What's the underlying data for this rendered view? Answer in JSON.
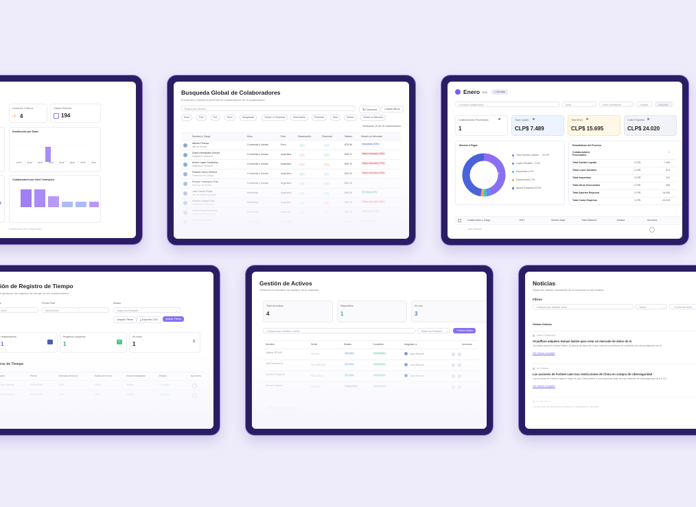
{
  "colors": {
    "accent": "#7c5cf0",
    "tablet_frame": "#2a1d63",
    "background": "#eeebfb"
  },
  "t1": {
    "card_a": "Usuarios Críticos",
    "card_a_value": "4",
    "card_b": "Vistas Ficticias",
    "card_b_value": "194",
    "chart1_title": "Distribución por Edad",
    "chart1_ticks": [
      "20-25",
      "25-30",
      "30-35",
      "35-40",
      "40-45",
      "45-50",
      "50-55",
      "55-60"
    ],
    "chart2_title": "Colaboradores por Nivel Jerárquico",
    "footer": "Distribución de Antigüedad"
  },
  "t2": {
    "title": "Busqueda Global de Colaboradores",
    "subtitle": "Encuentra y explora el perfil de los colaboradores de tu organización.",
    "search_placeholder": "Busca por nombre...",
    "btn_columns": "Columnas",
    "btn_clear": "Limpiar filtros",
    "chips": [
      "Edad",
      "País",
      "Rol",
      "Nivel",
      "Antigüedad",
      "Tiempo en Empresa",
      "Desempeño",
      "Potencial",
      "Área",
      "Salario",
      "Salario vs Mercado"
    ],
    "count": "Mostrando 10 de 25 colaboradores",
    "headers": [
      "Nombre y Cargo",
      "Área",
      "País",
      "Desempeño",
      "Potencial",
      "Salario",
      "Salario vs Mercado"
    ],
    "rows": [
      {
        "name": "Alfredo Pereira",
        "role": "Jefe de Ventas",
        "area": "Comercial y Ventas",
        "country": "Perú",
        "salary": "$75,99",
        "market": "Buscando (+4%)",
        "mc": "#e8f0ff",
        "mt": "#6a7fd8"
      },
      {
        "name": "Dulce Hernandez Gomez",
        "role": "Analista de Ventas Sr",
        "area": "Comercial y Ventas",
        "country": "Argentina",
        "salary": "$45,21",
        "market": "Mayor mercado (+8%)",
        "mc": "#fde6e6",
        "mt": "#d05050"
      },
      {
        "name": "Arturo López Contreras",
        "role": "Analista de Ventas Sr",
        "area": "Comercial y Ventas",
        "country": "Argentina",
        "salary": "$49,70",
        "market": "Mayor mercado (+7%)",
        "mc": "#fde6e6",
        "mt": "#d05050"
      },
      {
        "name": "Rafaela Yepes Medina",
        "role": "Vendedora de Campo",
        "area": "Comercial y Ventas",
        "country": "Argentina",
        "salary": "$26,02",
        "market": "Mayor mercado (+9%)",
        "mc": "#fde6e6",
        "mt": "#d05050"
      },
      {
        "name": "Enrique Velázquez Ruiz",
        "role": "Ejecutivo de Ventas",
        "area": "Comercial y Ventas",
        "country": "Argentina",
        "salary": "$32,10",
        "market": "-",
        "mc": "#ffffff",
        "mt": "#999999"
      },
      {
        "name": "Juan Carlos Rojas",
        "role": "Jefe de Marketing Digital",
        "area": "Marketing",
        "country": "Argentina",
        "salary": "$66,30",
        "market": "En rango (0%)",
        "mc": "#e6f7ee",
        "mt": "#3aa46a"
      },
      {
        "name": "Ximena Ortega Ruiz",
        "role": "Analista de Marketing",
        "area": "Marketing",
        "country": "Argentina",
        "salary": "$34,75",
        "market": "Mayor mercado (+5%)",
        "mc": "#fde6e6",
        "mt": "#d05050"
      },
      {
        "name": "Carlos Pérez Espinoza",
        "role": "Analista de Marketing Sr",
        "area": "Marketing",
        "country": "Argentina",
        "salary": "$40,18",
        "market": "Buscando (+2%)",
        "mc": "#e8f0ff",
        "mt": "#6a7fd8"
      },
      {
        "name": "Luisa Moreno Díaz",
        "role": "Diseñadora Gráfica",
        "area": "Marketing",
        "country": "Argentina",
        "salary": "$28,40",
        "market": "En rango (0%)",
        "mc": "#e6f7ee",
        "mt": "#3aa46a"
      }
    ]
  },
  "t3": {
    "month": "Enero",
    "year": "2026",
    "status": "Cerrado",
    "search_placeholder": "Buscar colaborador...",
    "filter_a": "Área",
    "filter_b": "Nivel Jerárquico",
    "btn_a": "Limpiar",
    "btn_b": "Exportar",
    "kpis": [
      {
        "label": "Colaboradores Procesados",
        "value": "1"
      },
      {
        "label": "Total Líquido",
        "value": "CLP$ 7.489"
      },
      {
        "label": "Total Bruto",
        "value": "CLP$ 15.695"
      },
      {
        "label": "Costo Empresa",
        "value": "CLP$ 24.020"
      }
    ],
    "donut_title": "Montos a Pagar",
    "donut_center": "24.020",
    "legend": [
      {
        "name": "Total Sueldo Líquido",
        "pct": "31.2%",
        "color": "#8a6ff2"
      },
      {
        "name": "Leyes Sociales",
        "pct": "2.4%",
        "color": "#5b8def"
      },
      {
        "name": "Impuestos",
        "pct": "1.4%",
        "color": "#3fc7c2"
      },
      {
        "name": "Descuentos",
        "pct": "1.7%",
        "color": "#f4a451"
      },
      {
        "name": "Aporte Empresa",
        "pct": "33.3%",
        "color": "#4b63d8"
      }
    ],
    "stats_title": "Estadísticas del Proceso",
    "stats": [
      {
        "k": "Colaboradores Procesados",
        "c": "",
        "v": "1"
      },
      {
        "k": "Total Sueldo Líquido",
        "c": "CLP$",
        "v": "7.489"
      },
      {
        "k": "Total Leyes Sociales",
        "c": "CLP$",
        "v": "512"
      },
      {
        "k": "Total Impuestos",
        "c": "CLP$",
        "v": "312"
      },
      {
        "k": "Total Otros Descuentos",
        "c": "CLP$",
        "v": "496"
      },
      {
        "k": "Total Aportes Empresa",
        "c": "CLP$",
        "v": "16.495"
      },
      {
        "k": "Total Costo Empresa",
        "c": "CLP$",
        "v": "24.020"
      }
    ],
    "table_headers": [
      "Colaborador y Cargo",
      "RUT",
      "Sueldo Base",
      "Total Haberes",
      "Estado",
      "Acciones"
    ],
    "table_row": "Juan Manuel"
  },
  "t4": {
    "title": "ión de Registro de Tiempo",
    "subtitle": "a gestionar los registros de tiempo de tus colaboradores",
    "field_a": "o",
    "field_a_value": "2026",
    "field_b": "Fecha Final",
    "field_b_value": "30/01/2026",
    "field_c": "Estado",
    "field_c_value": "Todos los Estados",
    "btn_clear": "Limpiar Filtros",
    "btn_export": "Exportar CSV",
    "btn_apply": "Aplicar Filtros",
    "cards": [
      {
        "label": "colaboradores",
        "value": "1"
      },
      {
        "label": "Registros completos",
        "value": "1"
      },
      {
        "label": "En curso",
        "value": "1"
      }
    ],
    "section": "ros de Tiempo",
    "headers": [
      "ador",
      "Fecha",
      "Entrada del turno",
      "Salida del turno",
      "Horas trabajadas",
      "Estado",
      "Acciones"
    ],
    "rows": [
      {
        "name": "Juan Manuel",
        "date": "05/01/2026",
        "in": "8:15",
        "out": "18:00",
        "hours": "9h45m",
        "state": "Completo"
      },
      {
        "name": "Juan Manuel",
        "date": "06/01/2026",
        "in": "8:30",
        "out": "18:00",
        "hours": "9h30m",
        "state": "Completo"
      }
    ]
  },
  "t5": {
    "title": "Gestión de Activos",
    "subtitle": "Gestiona el inventario de equipos de tu empresa",
    "cards": [
      {
        "label": "Total de Activos",
        "value": "4"
      },
      {
        "label": "Disponibles",
        "value": "1"
      },
      {
        "label": "En Uso",
        "value": "3"
      }
    ],
    "search_placeholder": "Buscar por nombre o serie...",
    "filter": "Todas las Estados",
    "btn_new": "+ Nuevo Activo",
    "headers": [
      "Nombre",
      "Serial",
      "Estado",
      "Condición",
      "Asignado a",
      "Acciones"
    ],
    "rows": [
      {
        "name": "Laptop HP 640",
        "serial": "SN-000",
        "state": "En Uso",
        "cond": "Excelente",
        "who": "Juan Manuel"
      },
      {
        "name": "Dell Precision 5",
        "serial": "SN-1930-201",
        "state": "En Uso",
        "cond": "Excelente",
        "who": "Juan Manuel"
      },
      {
        "name": "Monitor Philips 27",
        "serial": "SN-2193-01",
        "state": "En Uso",
        "cond": "Excelente",
        "who": "Juan Manuel"
      },
      {
        "name": "Mouse Logitech",
        "serial": "SN-3392",
        "state": "Disponible",
        "cond": "Excelente",
        "who": ""
      }
    ],
    "footer": "Últimos Movimientos"
  },
  "t6": {
    "title": "Noticias",
    "subtitle": "Sigue las últimas novedades de la empresa en los medios.",
    "filters_label": "Filtros",
    "search_placeholder": "Buscar por palabra clave",
    "filter_a": "Todos",
    "filter_b": "Fecha de inicio",
    "section": "Últimas Noticias",
    "news": [
      {
        "src": "Diario Financiero",
        "headline": "Cloudflare adquiere Human Native para crear un mercado de datos de IA",
        "body": "Cloudflare adquirió Human Native, la startup de datos de IA que conecta a creadores de contenido con desarrolladores de IA.",
        "link": "Ver noticia completa"
      },
      {
        "src": "La Tercera",
        "headline": "Las acciones de Fortinet caen tras restricciones de China en compra de ciberseguridad",
        "body": "Las acciones de Fortinet cayeron luego de que China pidiera a sus empresas dejar de usar software de ciberseguridad de EE.UU.",
        "link": "Ver noticia completa"
      },
      {
        "src": "El Mercurio",
        "headline": "",
        "body": "Los anuncios de Microsoft se enfocan en seguridad de agentes",
        "link": ""
      }
    ]
  }
}
